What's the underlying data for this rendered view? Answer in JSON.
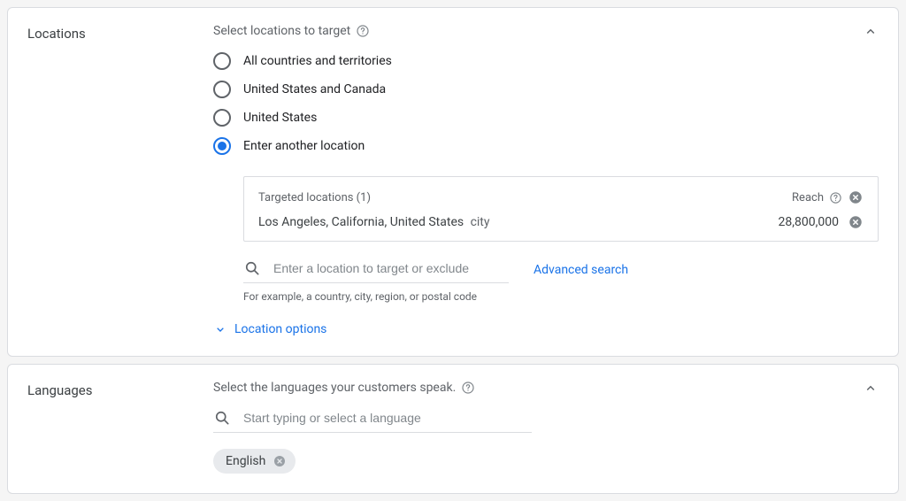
{
  "locations": {
    "label": "Locations",
    "prompt": "Select locations to target",
    "options": [
      "All countries and territories",
      "United States and Canada",
      "United States",
      "Enter another location"
    ],
    "targeted_header": "Targeted locations (1)",
    "reach_label": "Reach",
    "targeted": {
      "name": "Los Angeles, California, United States",
      "type": "city",
      "reach": "28,800,000"
    },
    "search_placeholder": "Enter a location to target or exclude",
    "advanced": "Advanced search",
    "hint": "For example, a country, city, region, or postal code",
    "options_link": "Location options"
  },
  "languages": {
    "label": "Languages",
    "prompt": "Select the languages your customers speak.",
    "search_placeholder": "Start typing or select a language",
    "chip": "English"
  }
}
